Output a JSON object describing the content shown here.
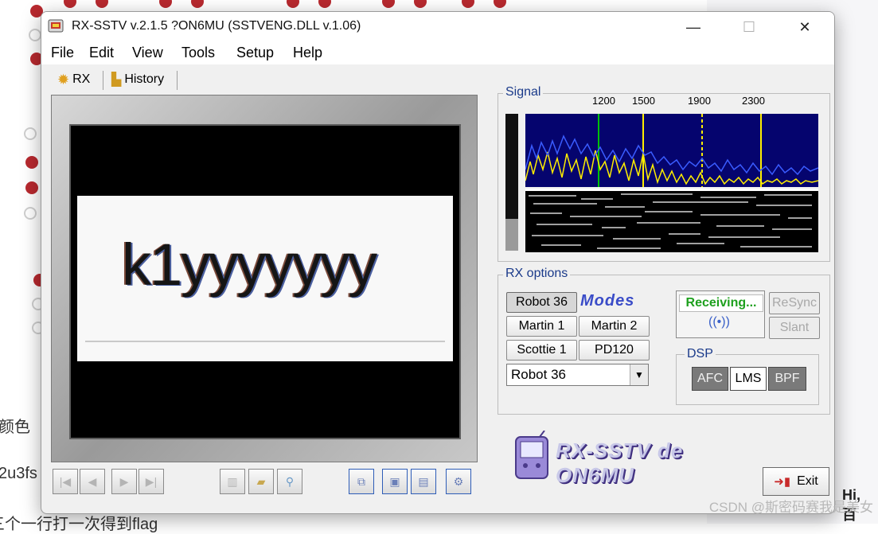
{
  "background": {
    "texts": [
      "颜色",
      "2u3fs",
      "三个一行打一次得到flag"
    ],
    "watermark": "CSDN @斯密码赛我是美女",
    "corner_text": "Hi, 百"
  },
  "window": {
    "title": "RX-SSTV v.2.1.5 ?ON6MU (SSTVENG.DLL v.1.06)",
    "controls": {
      "minimize": "—",
      "maximize": "☐",
      "close": "✕"
    }
  },
  "menu": [
    "File",
    "Edit",
    "View",
    "Tools",
    "Setup",
    "Help"
  ],
  "tabs": [
    {
      "label": "RX",
      "icon": "gear-icon"
    },
    {
      "label": "History",
      "icon": "folder-icon"
    }
  ],
  "image": {
    "text": "k1yyyyyyy"
  },
  "signal": {
    "label": "Signal",
    "freq_labels": [
      "1200",
      "1500",
      "1900",
      "2300"
    ],
    "spectrum_colors": {
      "background": "#05046e",
      "blue": "#3a5cff",
      "yellow": "#ffee00",
      "green": "#00c000"
    }
  },
  "rx_options": {
    "label": "RX options",
    "modes_logo": "Modes",
    "buttons": [
      "Robot 36",
      "Martin 1",
      "Martin 2",
      "Scottie 1",
      "PD120"
    ],
    "selected_mode": "Robot 36",
    "status": "Receiving...",
    "resync": "ReSync",
    "slant": "Slant"
  },
  "dsp": {
    "label": "DSP",
    "buttons": [
      {
        "label": "AFC",
        "state": "on"
      },
      {
        "label": "LMS",
        "state": "off"
      },
      {
        "label": "BPF",
        "state": "on"
      }
    ]
  },
  "logo": {
    "text": "RX-SSTV de ON6MU"
  },
  "exit": {
    "label": "Exit"
  }
}
